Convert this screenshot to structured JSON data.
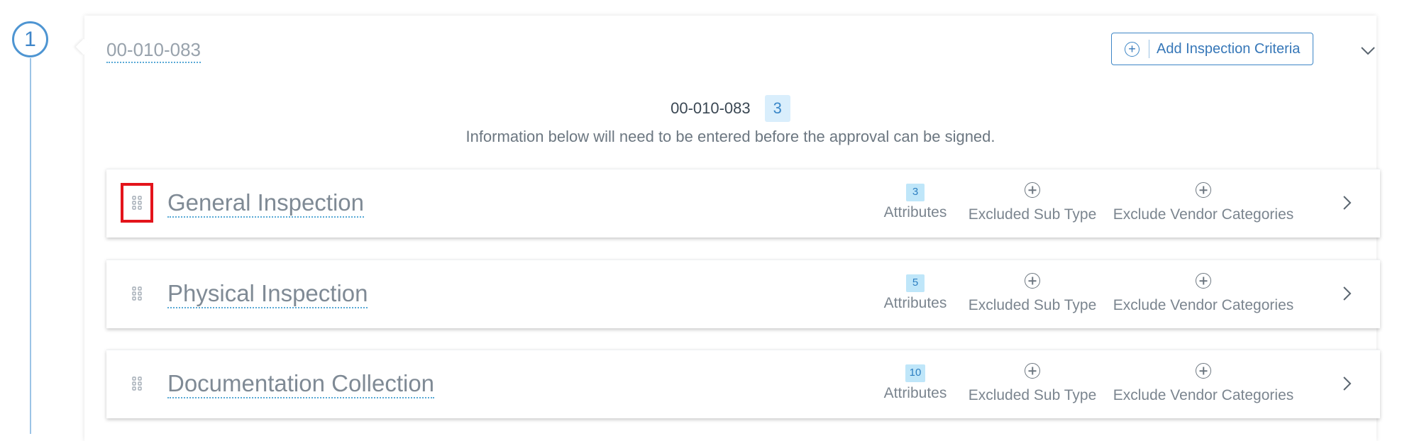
{
  "step": {
    "number": "1"
  },
  "card": {
    "title": "00-010-083",
    "add_button_label": "Add Inspection Criteria",
    "summary": {
      "id": "00-010-083",
      "count": "3",
      "note": "Information below will need to be entered before the approval can be signed."
    }
  },
  "rows": [
    {
      "title": "General Inspection",
      "attributes_count": "3",
      "attributes_label": "Attributes",
      "excluded_sub_type_label": "Excluded Sub Type",
      "exclude_vendor_label": "Exclude Vendor Categories"
    },
    {
      "title": "Physical Inspection",
      "attributes_count": "5",
      "attributes_label": "Attributes",
      "excluded_sub_type_label": "Excluded Sub Type",
      "exclude_vendor_label": "Exclude Vendor Categories"
    },
    {
      "title": "Documentation Collection",
      "attributes_count": "10",
      "attributes_label": "Attributes",
      "excluded_sub_type_label": "Excluded Sub Type",
      "exclude_vendor_label": "Exclude Vendor Categories"
    }
  ],
  "icons": {
    "drag_handle": "drag-handle-icon",
    "expand": "chevron-right-icon",
    "collapse": "chevron-down-icon",
    "add": "plus-circle-icon"
  },
  "colors": {
    "accent": "#3d86c6",
    "badge_bg": "#bfe6f9",
    "highlight": "#e3141b"
  }
}
